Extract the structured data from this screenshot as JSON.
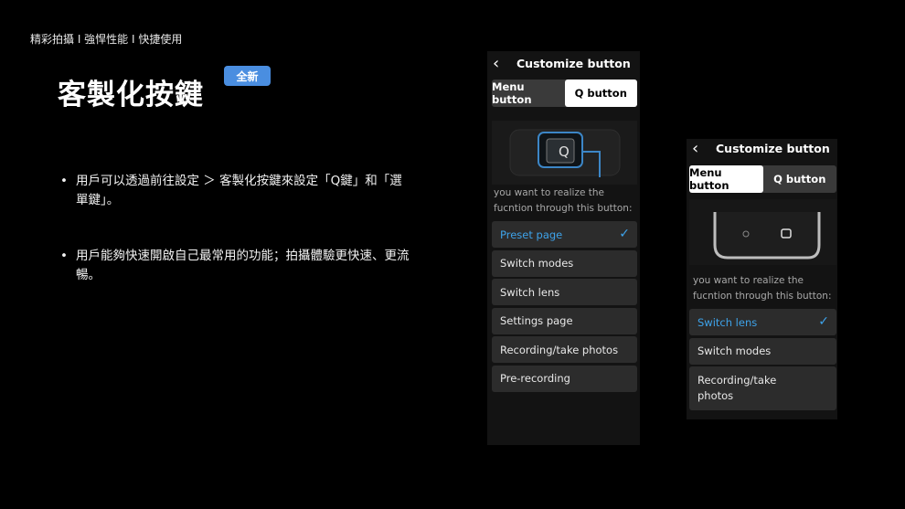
{
  "breadcrumb": "精彩拍攝 I 強悍性能 I 快捷使用",
  "title": "客製化按鍵",
  "badge": "全新",
  "bullets": [
    {
      "mark": "•",
      "text": "用戶可以透過前往設定 ＞ 客製化按鍵來設定「Q鍵」和「選單鍵」。"
    },
    {
      "mark": "•",
      "text": "用戶能夠快速開啟自己最常用的功能；拍攝體驗更快速、更流暢。"
    }
  ],
  "phone1": {
    "back_icon": "chevron-left-icon",
    "title": "Customize button",
    "tabs": [
      "Menu button",
      "Q button"
    ],
    "active_tab": 1,
    "key_label": "Q",
    "description": "you want to realize the fucntion through this button:",
    "options": [
      {
        "label": "Preset page",
        "selected": true
      },
      {
        "label": "Switch modes",
        "selected": false
      },
      {
        "label": "Switch lens",
        "selected": false
      },
      {
        "label": "Settings page",
        "selected": false
      },
      {
        "label": "Recording/take photos",
        "selected": false
      },
      {
        "label": "Pre-recording",
        "selected": false
      }
    ],
    "check_icon": "✓"
  },
  "phone2": {
    "back_icon": "chevron-left-icon",
    "title": "Customize button",
    "tabs": [
      "Menu button",
      "Q button"
    ],
    "active_tab": 0,
    "description": "you want to realize the fucntion through this button:",
    "options": [
      {
        "label": "Switch lens",
        "selected": true
      },
      {
        "label": "Switch modes",
        "selected": false
      },
      {
        "label": "Recording/take photos",
        "selected": false
      }
    ],
    "check_icon": "✓"
  },
  "colors": {
    "accent": "#3ea3ea",
    "badge": "#4a8ee0",
    "background": "#000000"
  }
}
